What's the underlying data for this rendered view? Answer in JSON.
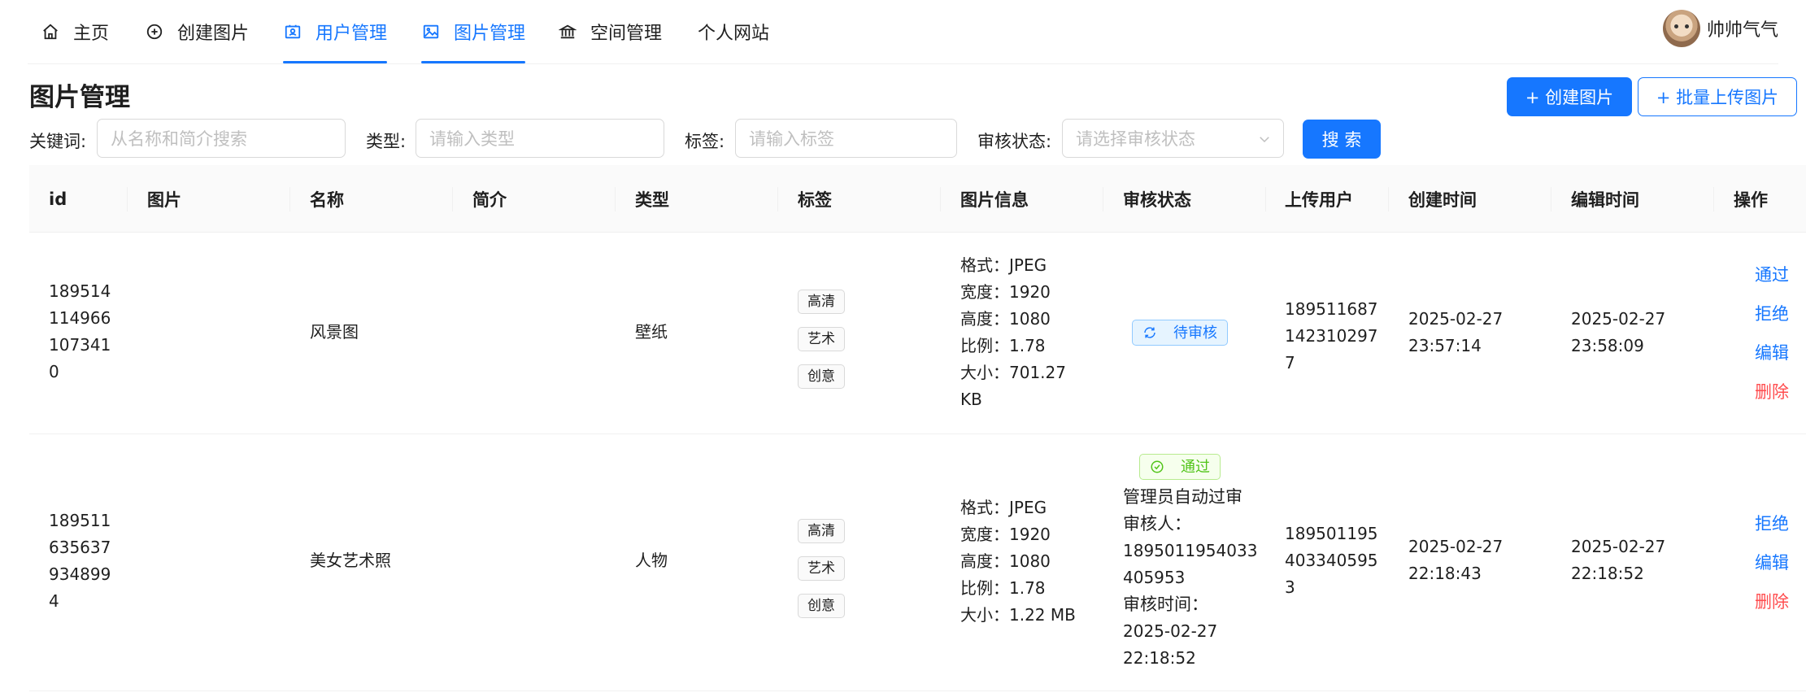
{
  "nav": {
    "items": [
      {
        "label": "主页",
        "icon": "home-icon"
      },
      {
        "label": "创建图片",
        "icon": "plus-circle-icon"
      },
      {
        "label": "用户管理",
        "icon": "user-card-icon",
        "active": true
      },
      {
        "label": "图片管理",
        "icon": "picture-icon",
        "active": true
      },
      {
        "label": "空间管理",
        "icon": "bank-icon"
      },
      {
        "label": "个人网站",
        "icon": ""
      }
    ],
    "user_name": "帅帅气气"
  },
  "page": {
    "title": "图片管理",
    "create_button": "+ 创建图片",
    "batch_upload_button": "+ 批量上传图片"
  },
  "search": {
    "keyword_label": "关键词:",
    "keyword_placeholder": "从名称和简介搜索",
    "type_label": "类型:",
    "type_placeholder": "请输入类型",
    "tags_label": "标签:",
    "tags_placeholder": "请输入标签",
    "status_label": "审核状态:",
    "status_placeholder": "请选择审核状态",
    "search_button": "搜 索"
  },
  "table": {
    "columns": [
      "id",
      "图片",
      "名称",
      "简介",
      "类型",
      "标签",
      "图片信息",
      "审核状态",
      "上传用户",
      "创建时间",
      "编辑时间",
      "操作"
    ],
    "rows": [
      {
        "id_lines": [
          "189514",
          "114966",
          "107341",
          "0"
        ],
        "name": "风景图",
        "intro": "",
        "category": "壁纸",
        "tags": [
          "高清",
          "艺术",
          "创意"
        ],
        "info_lines": [
          "格式：JPEG",
          "宽度：1920",
          "高度：1080",
          "比例：1.78",
          "大小：701.27",
          "KB"
        ],
        "status": "待审核",
        "review_lines": [],
        "user_lines": [
          "189511687",
          "142310297",
          "7"
        ],
        "create_lines": [
          "2025-02-27",
          "23:57:14"
        ],
        "edit_lines": [
          "2025-02-27",
          "23:58:09"
        ],
        "actions": [
          {
            "label": "通过",
            "danger": false
          },
          {
            "label": "拒绝",
            "danger": false
          },
          {
            "label": "编辑",
            "danger": false
          },
          {
            "label": "删除",
            "danger": true
          }
        ]
      },
      {
        "id_lines": [
          "189511",
          "635637",
          "934899",
          "4"
        ],
        "name": "美女艺术照",
        "intro": "",
        "category": "人物",
        "tags": [
          "高清",
          "艺术",
          "创意"
        ],
        "info_lines": [
          "格式：JPEG",
          "宽度：1920",
          "高度：1080",
          "比例：1.78",
          "大小：1.22 MB"
        ],
        "status": "通过",
        "review_lines": [
          "管理员自动过审",
          "审核人：",
          "1895011954033",
          "405953",
          "审核时间：",
          "2025-02-27",
          "22:18:52"
        ],
        "user_lines": [
          "189501195",
          "403340595",
          "3"
        ],
        "create_lines": [
          "2025-02-27",
          "22:18:43"
        ],
        "edit_lines": [
          "2025-02-27",
          "22:18:52"
        ],
        "actions": [
          {
            "label": "拒绝",
            "danger": false
          },
          {
            "label": "编辑",
            "danger": false
          },
          {
            "label": "删除",
            "danger": true
          }
        ]
      }
    ]
  }
}
